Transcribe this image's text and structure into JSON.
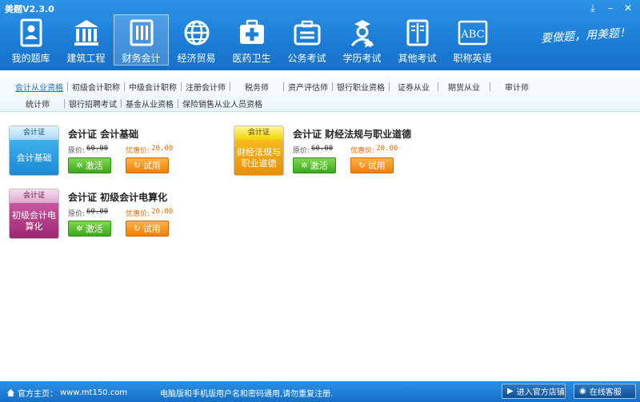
{
  "app": {
    "title": "美题V2.3.0"
  },
  "window_controls": [
    {
      "name": "download-icon",
      "glyph": "⤓"
    },
    {
      "name": "minimize-icon",
      "glyph": "–"
    },
    {
      "name": "close-icon",
      "glyph": "✕"
    }
  ],
  "nav": {
    "items": [
      {
        "label": "我的题库",
        "icon": "person-card-icon"
      },
      {
        "label": "建筑工程",
        "icon": "building-icon"
      },
      {
        "label": "财务会计",
        "icon": "ledger-book-icon",
        "active": true
      },
      {
        "label": "经济贸易",
        "icon": "globe-icon"
      },
      {
        "label": "医药卫生",
        "icon": "medical-kit-icon"
      },
      {
        "label": "公务考试",
        "icon": "briefcase-icon"
      },
      {
        "label": "学历考试",
        "icon": "graduate-icon"
      },
      {
        "label": "其他考试",
        "icon": "open-book-icon"
      },
      {
        "label": "职称英语",
        "icon": "abc-board-icon"
      }
    ],
    "slogan": "要做题，用美题！"
  },
  "subnav": {
    "row1": [
      "会计从业资格",
      "初级会计职称",
      "中级会计职称",
      "注册会计师",
      "税务师",
      "资产评估师",
      "银行职业资格",
      "证券从业",
      "期货从业",
      "审计师"
    ],
    "row2": [
      "统计师",
      "银行招聘考试",
      "基金从业资格",
      "保险销售从业人员资格"
    ],
    "active": "会计从业资格"
  },
  "products": [
    {
      "cover_tag": "会计证",
      "cover_name": "会计基础",
      "cover_color": "blue",
      "title": "会计证 会计基础",
      "orig_label": "原价:",
      "orig_price": "60.00",
      "disc_label": "优惠价:",
      "disc_price": "20.00",
      "activate_label": "激活",
      "trial_label": "试用"
    },
    {
      "cover_tag": "会计证",
      "cover_name": "财经法规与职业道德",
      "cover_color": "yellow",
      "title": "会计证 财经法规与职业道德",
      "orig_label": "原价:",
      "orig_price": "60.00",
      "disc_label": "优惠价:",
      "disc_price": "20.00",
      "activate_label": "激活",
      "trial_label": "试用"
    },
    {
      "cover_tag": "会计证",
      "cover_name": "初级会计电算化",
      "cover_color": "purple",
      "title": "会计证 初级会计电算化",
      "orig_label": "原价:",
      "orig_price": "60.00",
      "disc_label": "优惠价:",
      "disc_price": "20.00",
      "activate_label": "激活",
      "trial_label": "试用"
    }
  ],
  "status": {
    "home_label": "官方主页：",
    "home_url": "www.mt150.com",
    "notice": "电脑版和手机版用户名和密码通用,请勿重复注册.",
    "store_label": "进入官方店铺",
    "service_label": "在线客服"
  },
  "colors": {
    "brand_blue": "#1d7fd8",
    "activate_green": "#3ba81b",
    "trial_orange": "#f07e06",
    "discount_orange": "#ee6a00"
  }
}
